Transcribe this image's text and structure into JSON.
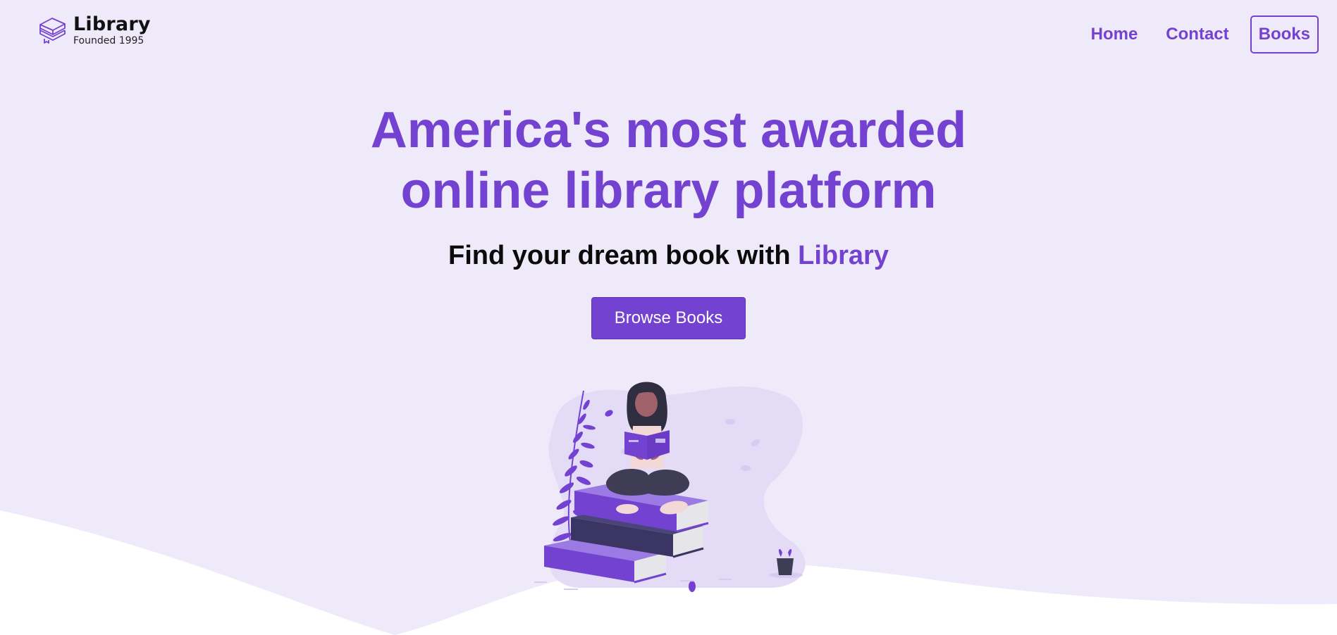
{
  "brand": {
    "name": "Library",
    "tagline": "Founded 1995"
  },
  "nav": {
    "home": "Home",
    "contact": "Contact",
    "books": "Books"
  },
  "hero": {
    "title_line1": "America's most awarded",
    "title_line2": "online library platform",
    "subtitle_prefix": "Find your dream book with ",
    "subtitle_accent": "Library",
    "cta_label": "Browse Books"
  },
  "colors": {
    "accent": "#7442d1",
    "background": "#efeafa",
    "wave": "#ffffff"
  },
  "icons": {
    "logo": "stacked-books-icon"
  }
}
